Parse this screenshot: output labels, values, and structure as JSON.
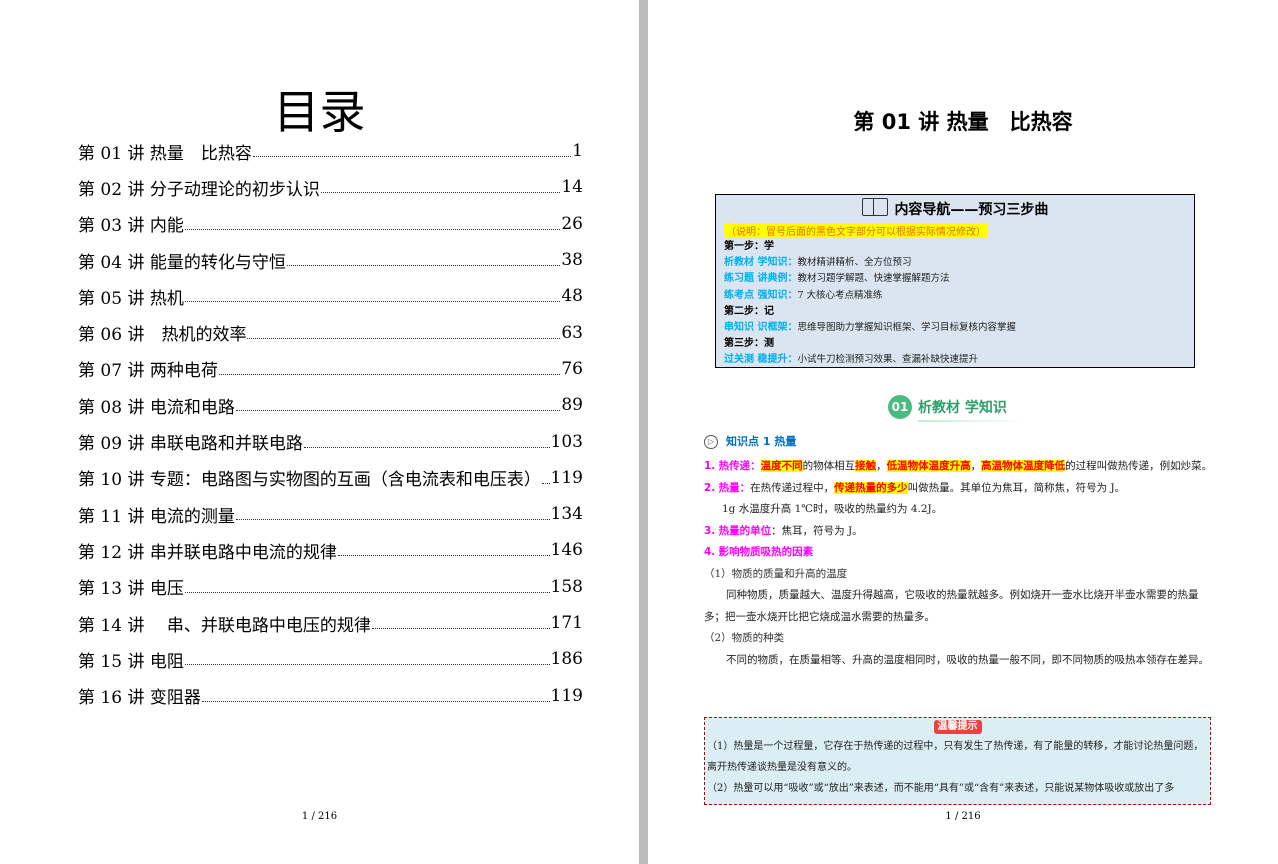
{
  "toc": {
    "title": "目录",
    "entries": [
      {
        "label": "第 01 讲  热量　比热容",
        "page": "1"
      },
      {
        "label": "第 02 讲  分子动理论的初步认识",
        "page": "14"
      },
      {
        "label": "第 03 讲  内能",
        "page": "26"
      },
      {
        "label": "第 04 讲  能量的转化与守恒",
        "page": "38"
      },
      {
        "label": "第 05 讲  热机",
        "page": "48"
      },
      {
        "label": "第 06 讲　热机的效率",
        "page": "63"
      },
      {
        "label": "第 07 讲  两种电荷",
        "page": "76"
      },
      {
        "label": "第 08 讲  电流和电路",
        "page": "89"
      },
      {
        "label": "第 09 讲  串联电路和并联电路",
        "page": "103"
      },
      {
        "label": "第 10 讲  专题：电路图与实物图的互画（含电流表和电压表）",
        "page": "119"
      },
      {
        "label": "第 11 讲  电流的测量",
        "page": "134"
      },
      {
        "label": "第 12 讲  串并联电路中电流的规律",
        "page": "146"
      },
      {
        "label": "第 13 讲  电压",
        "page": "158"
      },
      {
        "label": "第 14 讲　 串、并联电路中电压的规律",
        "page": "171"
      },
      {
        "label": "第 15 讲  电阻",
        "page": "186"
      },
      {
        "label": "第 16 讲  变阻器",
        "page": "119"
      }
    ],
    "page_number": "1 / 216"
  },
  "lesson": {
    "title": "第 01 讲  热量　比热容",
    "nav": {
      "heading": "内容导航——预习三步曲",
      "note": "（说明：冒号后面的黑色文字部分可以根据实际情况修改）",
      "step1": "第一步：学",
      "row1_key": "析教材 学知识：",
      "row1_desc": "教材精讲精析、全方位预习",
      "row2_key": "练习题 讲典例：",
      "row2_desc": "教材习题学解题、快速掌握解题方法",
      "row3_key": "练考点 强知识：",
      "row3_desc": "7 大核心考点精准练",
      "step2": "第二步：记",
      "row4_key": "串知识 识框架：",
      "row4_desc": "思维导图助力掌握知识框架、学习目标复核内容掌握",
      "step3": "第三步：测",
      "row5_key": "过关测 稳提升：",
      "row5_desc": "小试牛刀检测预习效果、查漏补缺快速提升"
    },
    "section": {
      "num": "01",
      "label": "析教材 学知识"
    },
    "kp_title": "知识点 1  热量",
    "p1": {
      "num": "1.",
      "term": "热传递：",
      "h1": "温度不同",
      "t1": "的物体相互",
      "h2": "接触",
      "t2": "，",
      "h3": "低温物体温度升高",
      "t3": "，",
      "h4": "高温物体温度降低",
      "t4": "的过程叫做热传递，例如炒菜。"
    },
    "p2": {
      "num": "2.",
      "term": "热量：",
      "t1": "在热传递过程中，",
      "h1": "传递热量的多少",
      "t2": "叫做热量。其单位为焦耳，简称焦，符号为 J。"
    },
    "p2b": "1g 水温度升高 1℃时，吸收的热量约为 4.2J。",
    "p3": {
      "num": "3.",
      "term": "热量的单位",
      "t1": "：焦耳，符号为 J。"
    },
    "p4": {
      "num": "4.",
      "term": "影响物质吸热的因素"
    },
    "p5": "（1）物质的质量和升高的温度",
    "p6": "同种物质，质量越大、温度升得越高，它吸收的热量就越多。例如烧开一壶水比烧开半壶水需要的热量多；把一壶水烧开比把它烧成温水需要的热量多。",
    "p7": "（2）物质的种类",
    "p8": "不同的物质，在质量相等、升高的温度相同时，吸收的热量一般不同，即不同物质的吸热本领存在差异。",
    "tips": {
      "tag": "温馨提示",
      "line1": "（1）热量是一个过程量，它存在于热传递的过程中，只有发生了热传递，有了能量的转移，才能讨论热量问题，离开热传递谈热量是没有意义的。",
      "line2": "（2）热量可以用“吸收”或“放出”来表述，而不能用“具有”或“含有”来表述，只能说某物体吸收或放出了多"
    },
    "page_number": "1 / 216"
  }
}
